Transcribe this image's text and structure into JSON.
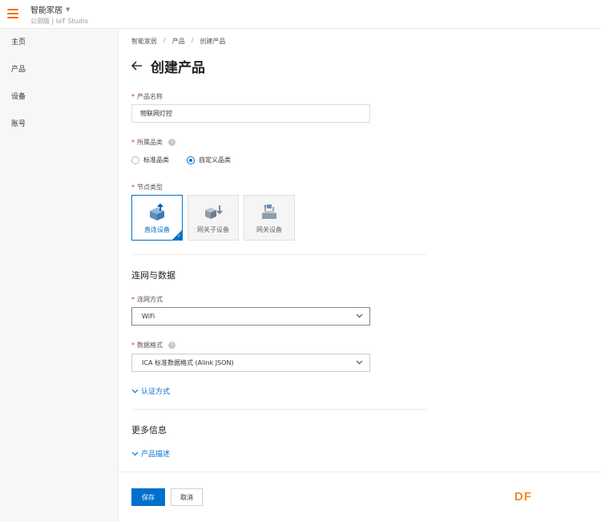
{
  "header": {
    "app_name": "智能家居",
    "subtitle": "公测版 | IoT Studio"
  },
  "sidebar": {
    "items": [
      {
        "label": "主页"
      },
      {
        "label": "产品"
      },
      {
        "label": "设备"
      },
      {
        "label": "账号"
      }
    ]
  },
  "breadcrumb": {
    "items": [
      "智能家居",
      "产品",
      "创建产品"
    ],
    "separator": "/"
  },
  "page": {
    "back_icon": "arrow-left-icon",
    "title": "创建产品"
  },
  "form": {
    "required_mark": "*",
    "product_name": {
      "label": "产品名称",
      "value": "物联网灯控"
    },
    "category": {
      "label": "所属品类",
      "options": [
        {
          "label": "标准品类",
          "selected": false
        },
        {
          "label": "自定义品类",
          "selected": true
        }
      ]
    },
    "node_type": {
      "label": "节点类型",
      "options": [
        {
          "label": "直连设备",
          "selected": true,
          "icon": "direct-device-icon"
        },
        {
          "label": "网关子设备",
          "selected": false,
          "icon": "gateway-sub-device-icon"
        },
        {
          "label": "网关设备",
          "selected": false,
          "icon": "gateway-device-icon"
        }
      ]
    },
    "network_section_title": "连网与数据",
    "network_method": {
      "label": "连网方式",
      "value": "WiFi"
    },
    "data_format": {
      "label": "数据格式",
      "value": "ICA 标准数据格式 (Alink JSON)"
    },
    "auth_link": "认证方式",
    "more_section_title": "更多信息",
    "desc_link": "产品描述"
  },
  "actions": {
    "save_label": "保存",
    "cancel_label": "取消"
  },
  "watermark": "DF",
  "colors": {
    "primary": "#0070cc",
    "brand_orange": "#ff6a00",
    "required": "#e23333"
  }
}
